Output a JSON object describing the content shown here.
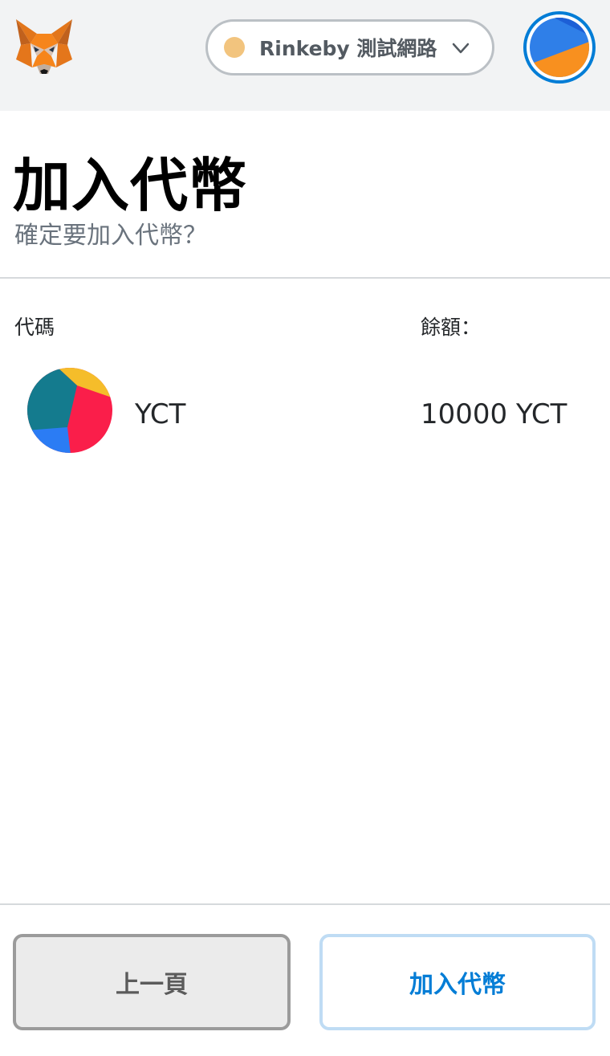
{
  "header": {
    "logo_icon": "metamask-fox-icon",
    "network": {
      "name": "Rinkeby 測試網路",
      "dot_color": "#f2c47e",
      "dropdown_icon": "chevron-down-icon"
    },
    "account_icon": "account-identicon-icon"
  },
  "page": {
    "title": "加入代幣",
    "subtitle": "確定要加入代幣？"
  },
  "table": {
    "columns": {
      "symbol": "代碼",
      "balance": "餘額："
    },
    "rows": [
      {
        "icon": "token-identicon-icon",
        "symbol": "YCT",
        "balance": "10000 YCT"
      }
    ]
  },
  "footer": {
    "back_label": "上一頁",
    "add_label": "加入代幣"
  },
  "colors": {
    "accent": "#037dd6",
    "header_bg": "#f2f3f4",
    "network_dot": "#f2c47e"
  }
}
